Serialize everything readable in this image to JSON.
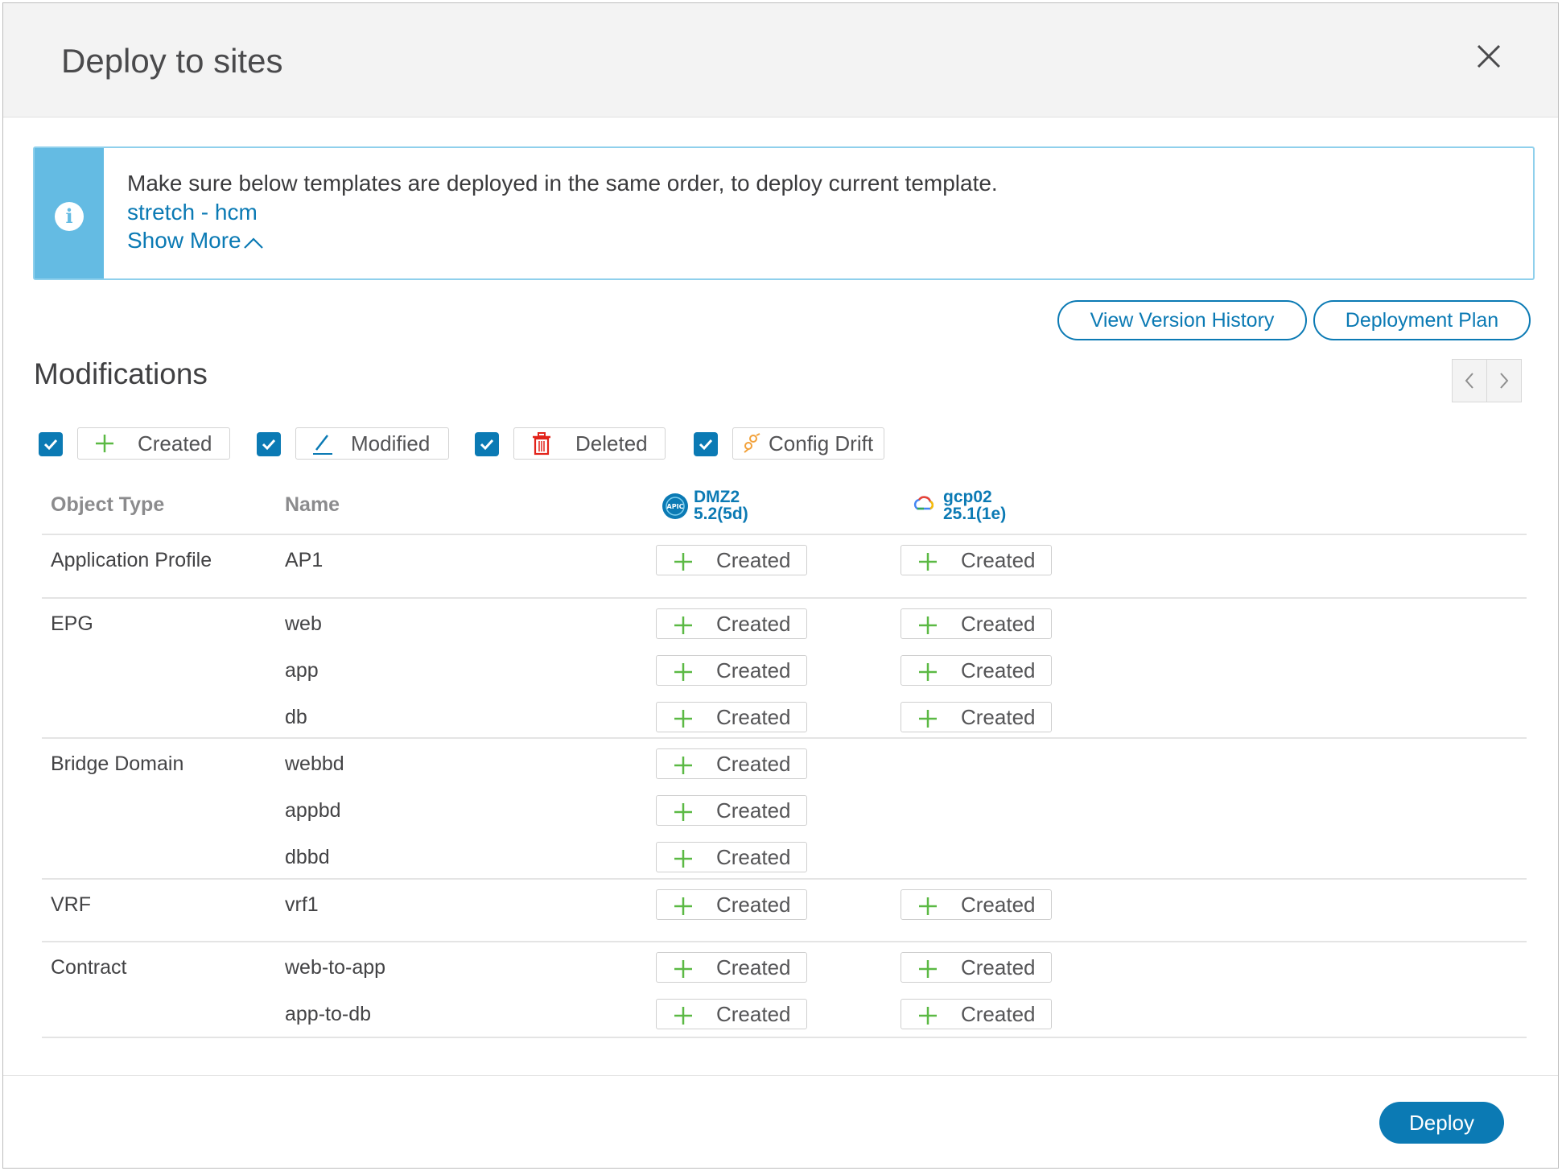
{
  "modal": {
    "title": "Deploy to sites"
  },
  "banner": {
    "message": "Make sure below templates are deployed in the same order, to deploy current template.",
    "template_link": "stretch - hcm",
    "show_more": "Show More"
  },
  "actions": {
    "view_version_history": "View Version History",
    "deployment_plan": "Deployment Plan"
  },
  "section": {
    "title": "Modifications"
  },
  "filters": [
    {
      "label": "Created",
      "checked": true,
      "icon": "plus-icon"
    },
    {
      "label": "Modified",
      "checked": true,
      "icon": "pencil-icon"
    },
    {
      "label": "Deleted",
      "checked": true,
      "icon": "trash-icon"
    },
    {
      "label": "Config Drift",
      "checked": true,
      "icon": "config-drift-icon"
    }
  ],
  "table": {
    "headers": {
      "object_type": "Object Type",
      "name": "Name"
    },
    "sites": [
      {
        "name": "DMZ2",
        "version": "5.2(5d)",
        "icon": "apic-icon",
        "logo_text": "APIC"
      },
      {
        "name": "gcp02",
        "version": "25.1(1e)",
        "icon": "google-cloud-icon"
      }
    ],
    "groups": [
      {
        "object_type": "Application Profile",
        "rows": [
          {
            "name": "AP1",
            "site1": "Created",
            "site2": "Created"
          }
        ]
      },
      {
        "object_type": "EPG",
        "rows": [
          {
            "name": "web",
            "site1": "Created",
            "site2": "Created"
          },
          {
            "name": "app",
            "site1": "Created",
            "site2": "Created"
          },
          {
            "name": "db",
            "site1": "Created",
            "site2": "Created"
          }
        ]
      },
      {
        "object_type": "Bridge Domain",
        "rows": [
          {
            "name": "webbd",
            "site1": "Created",
            "site2": ""
          },
          {
            "name": "appbd",
            "site1": "Created",
            "site2": ""
          },
          {
            "name": "dbbd",
            "site1": "Created",
            "site2": ""
          }
        ]
      },
      {
        "object_type": "VRF",
        "rows": [
          {
            "name": "vrf1",
            "site1": "Created",
            "site2": "Created"
          }
        ]
      },
      {
        "object_type": "Contract",
        "rows": [
          {
            "name": "web-to-app",
            "site1": "Created",
            "site2": "Created"
          },
          {
            "name": "app-to-db",
            "site1": "Created",
            "site2": "Created"
          }
        ]
      }
    ]
  },
  "footer": {
    "deploy": "Deploy"
  },
  "colors": {
    "accent": "#0b7ab4",
    "info": "#64bbe3",
    "created_green": "#5bb944",
    "deleted_red": "#e2231a",
    "drift_orange": "#f2a13a"
  }
}
